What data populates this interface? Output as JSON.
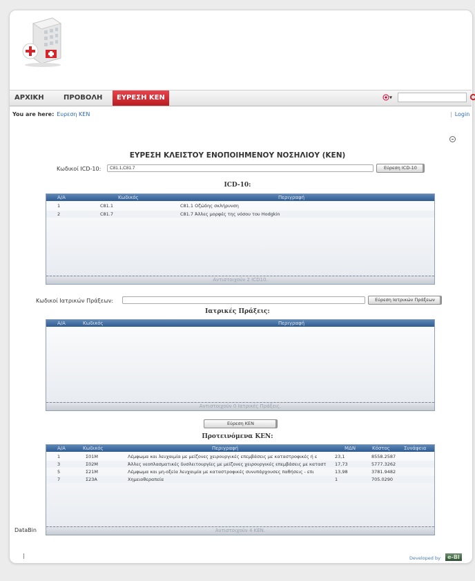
{
  "nav": {
    "items": [
      {
        "label": "ΑΡΧΙΚΗ"
      },
      {
        "label": "ΠΡΟΒΟΛΗ"
      },
      {
        "label": "ΕΥΡΕΣΗ ΚΕΝ"
      }
    ],
    "language_selector": "▾",
    "search_placeholder": ""
  },
  "breadcrumb": {
    "prefix": "You are here:",
    "current": "Ευρεση ΚΕΝ"
  },
  "login": {
    "separator": "|",
    "label": "Login"
  },
  "page": {
    "title": "ΕΥΡΕΣΗ ΚΛΕΙΣΤΟΥ ΕΝΟΠΟΙΗΜΕΝΟΥ ΝΟΣΗΛΙΟΥ (ΚΕΝ)",
    "icd_label": "Κωδικοί ICD-10:",
    "icd_value": "C81.1,C81.7",
    "icd_button": "Εύρεση ICD-10",
    "icd_section": "ICD-10:",
    "proc_label": "Κωδικοί Ιατρικών Πράξεων:",
    "proc_value": "",
    "proc_button": "Εύρεση Ιατρικών Πράξεων",
    "proc_section": "Ιατρικές Πράξεις:",
    "ken_button": "Εύρεση ΚΕΝ",
    "ken_section": "Προτεινόμενα ΚΕΝ:",
    "datab_label": "DataBin"
  },
  "icd_grid": {
    "headers": {
      "aa": "Α/Α",
      "code": "Κωδικός",
      "desc": "Περιγραφή"
    },
    "rows": [
      {
        "aa": "1",
        "code": "C81.1",
        "desc": "C81.1 Οζώδης σκλήρυνση"
      },
      {
        "aa": "2",
        "code": "C81.7",
        "desc": "C81.7 Άλλες μορφές της νόσου του Hodgkin"
      }
    ],
    "footer": "Αντιστοιχούν 2 ICD10."
  },
  "proc_grid": {
    "headers": {
      "aa": "Α/Α",
      "code": "Κωδικός",
      "desc": "Περιγραφή"
    },
    "rows": [],
    "footer": "Αντιστοιχούν 0 Ιατρικές Πράξεις."
  },
  "ken_grid": {
    "headers": {
      "aa": "Α/Α",
      "code": "Κωδικός",
      "desc": "Περιγραφή",
      "mdn": "ΜΔΝ",
      "cost": "Κόστος",
      "syn": "Συνάφεια"
    },
    "rows": [
      {
        "aa": "1",
        "code": "Σ01Μ",
        "desc": "Λέμφωμα και λευχαιμία με μείζονες χειρουργικές επεμβάσεις με καταστροφικές ή ε",
        "mdn": "23,1",
        "cost": "8558.2587"
      },
      {
        "aa": "3",
        "code": "Σ02Μ",
        "desc": "Άλλες νεοπλασματικές δυσλειτουργίες με μείζονες χειρουργικές επεμβάσεις με καταστ",
        "mdn": "17,73",
        "cost": "5777.3262"
      },
      {
        "aa": "5",
        "code": "Σ21Μ",
        "desc": "Λέμφωμα και μη-οξεία λευχαιμία με καταστροφικές συνυπάρχουσες παθήσεις - επι",
        "mdn": "13,98",
        "cost": "3781.9482"
      },
      {
        "aa": "7",
        "code": "Σ23Α",
        "desc": "Χημειοθεραπεία",
        "mdn": "1",
        "cost": "705.0290"
      }
    ],
    "footer": "Αντιστοιχούν 4 ΚΕΝ."
  },
  "footer": {
    "pipe": "|",
    "powered": "Developed by",
    "brand": "e-BI"
  },
  "colors": {
    "accent": "#c9252c",
    "grid_header": "#3a659c",
    "link": "#2e6ab0"
  }
}
